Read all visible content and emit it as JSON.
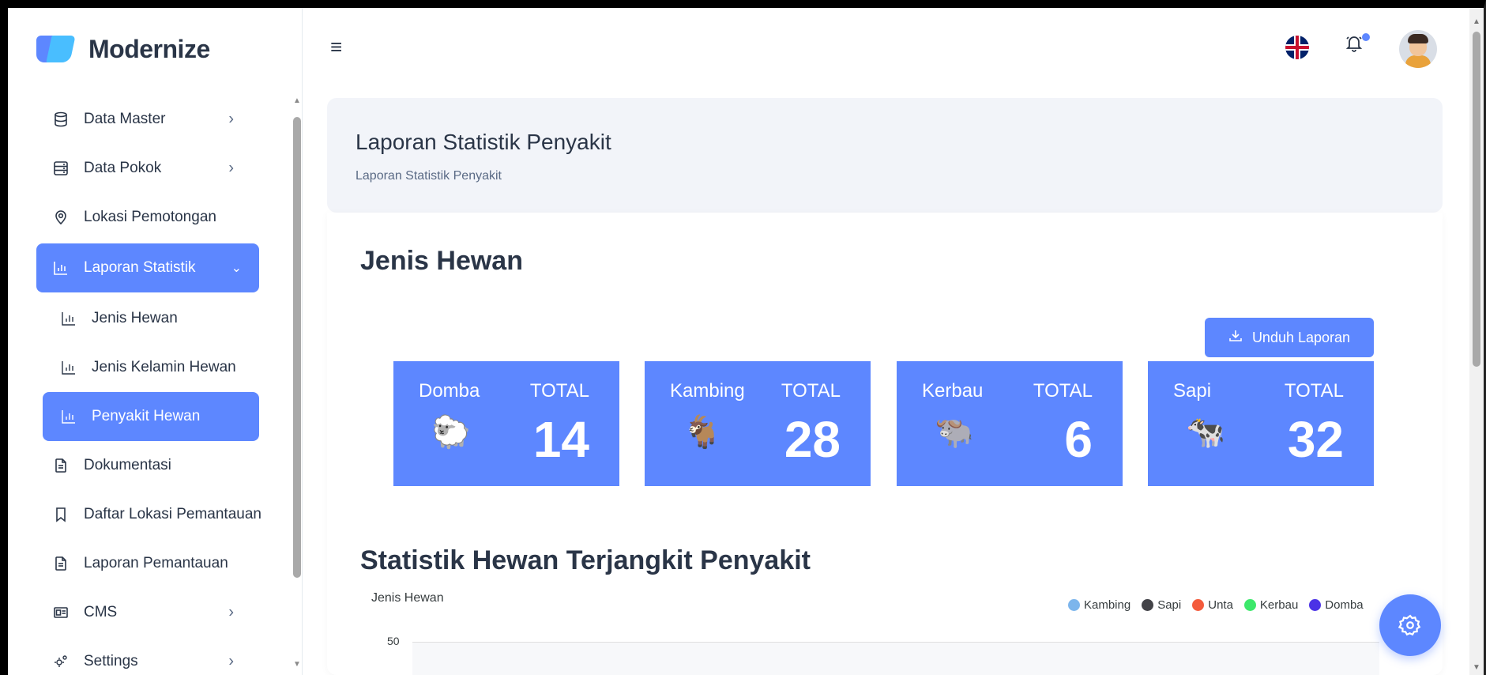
{
  "brand": {
    "name": "Modernize"
  },
  "sidebar": {
    "items": [
      {
        "label": "Data Master",
        "icon": "database-icon",
        "has_chevron": true
      },
      {
        "label": "Data Pokok",
        "icon": "server-icon",
        "has_chevron": true
      },
      {
        "label": "Lokasi Pemotongan",
        "icon": "map-pin-icon",
        "has_chevron": false
      },
      {
        "label": "Laporan Statistik",
        "icon": "bar-chart-icon",
        "has_chevron": true,
        "active": true
      },
      {
        "label": "Jenis Hewan",
        "icon": "bar-chart-icon",
        "sub": true
      },
      {
        "label": "Jenis Kelamin Hewan",
        "icon": "bar-chart-icon",
        "sub": true
      },
      {
        "label": "Penyakit Hewan",
        "icon": "bar-chart-icon",
        "sub": true,
        "active": true
      },
      {
        "label": "Dokumentasi",
        "icon": "file-text-icon",
        "has_chevron": false
      },
      {
        "label": "Daftar Lokasi Pemantauan",
        "icon": "bookmark-icon",
        "has_chevron": false
      },
      {
        "label": "Laporan Pemantauan",
        "icon": "file-text-icon",
        "has_chevron": false
      },
      {
        "label": "CMS",
        "icon": "news-icon",
        "has_chevron": true
      },
      {
        "label": "Settings",
        "icon": "settings-icon",
        "has_chevron": true
      }
    ]
  },
  "header": {
    "menu_icon": "≡",
    "flag_icon": "uk-flag-icon",
    "bell_icon": "🔔"
  },
  "page": {
    "title": "Laporan Statistik Penyakit",
    "breadcrumb": "Laporan Statistik Penyakit",
    "section_title": "Jenis Hewan",
    "download_label": "Unduh Laporan",
    "chart_section_title": "Statistik Hewan Terjangkit Penyakit"
  },
  "stats": [
    {
      "name": "Domba",
      "label": "TOTAL",
      "value": "14",
      "icon": "🐑"
    },
    {
      "name": "Kambing",
      "label": "TOTAL",
      "value": "28",
      "icon": "🐐"
    },
    {
      "name": "Kerbau",
      "label": "TOTAL",
      "value": "6",
      "icon": "🐃"
    },
    {
      "name": "Sapi",
      "label": "TOTAL",
      "value": "32",
      "icon": "🐄"
    }
  ],
  "chart_data": {
    "type": "bar",
    "ylabel": "Jenis Hewan",
    "yticks_visible": [
      "50"
    ],
    "series": [
      {
        "name": "Kambing",
        "color": "#7cb5ec"
      },
      {
        "name": "Sapi",
        "color": "#434348"
      },
      {
        "name": "Unta",
        "color": "#f45b3c"
      },
      {
        "name": "Kerbau",
        "color": "#3de86b"
      },
      {
        "name": "Domba",
        "color": "#4b32e6"
      }
    ]
  },
  "colors": {
    "accent": "#5d87ff",
    "text": "#2a3547"
  }
}
